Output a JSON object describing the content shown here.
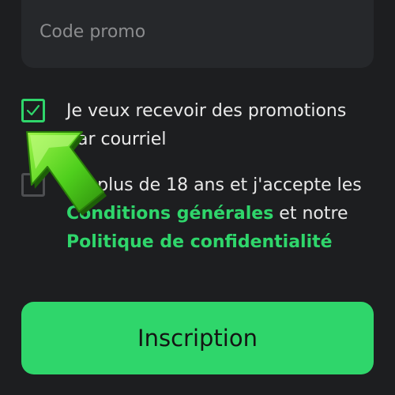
{
  "promo": {
    "placeholder": "Code promo"
  },
  "consents": {
    "newsletter_label": "Je veux recevoir des promotions par courriel",
    "terms_prefix": "J'ai plus de 18 ans et j'accepte les ",
    "terms_link": "Conditions générales",
    "terms_middle": " et notre ",
    "privacy_link": "Politique de confidentialité"
  },
  "submit": {
    "label": "Inscription"
  },
  "colors": {
    "accent": "#2fd66b",
    "background": "#1d1e20",
    "field": "#26282b"
  },
  "icons": {
    "check": "check-icon",
    "pointer": "arrow-pointer-icon"
  }
}
